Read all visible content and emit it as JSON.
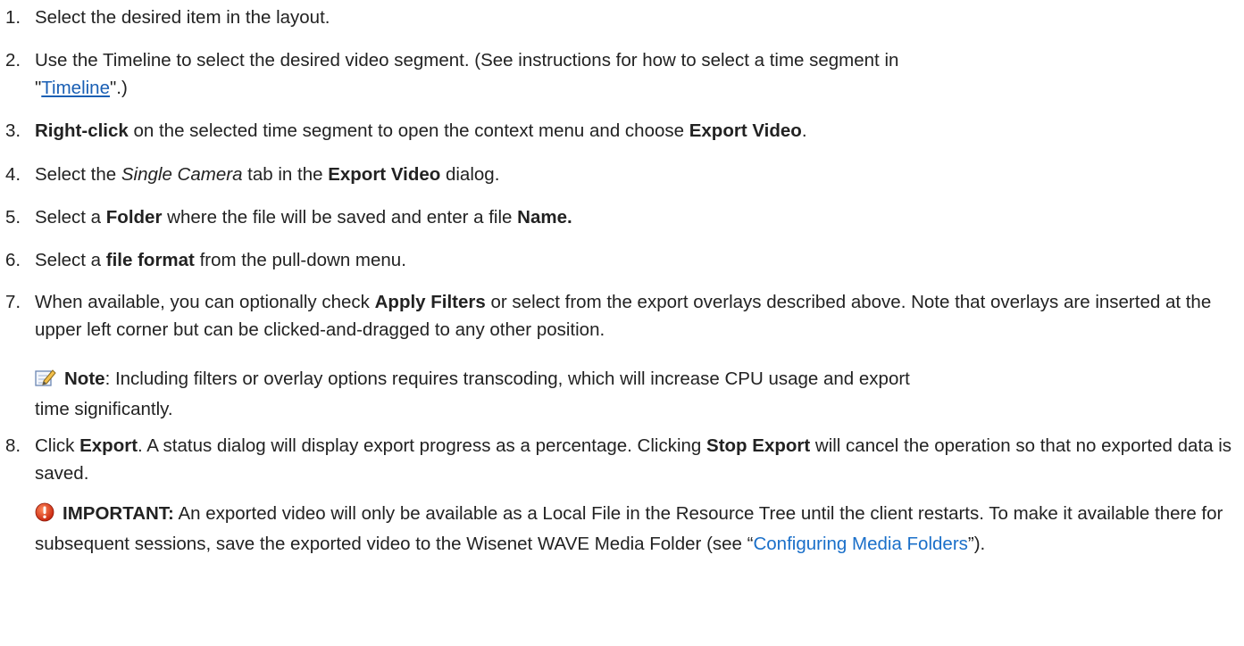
{
  "steps": [
    {
      "num": "1.",
      "text": "Select the desired item in the layout."
    },
    {
      "num": "2.",
      "part1": "Use the Timeline to select the desired video segment. (See instructions for how to select a time segment in",
      "quote_open": "\"",
      "link": "Timeline",
      "quote_close": "\".)"
    },
    {
      "num": "3.",
      "bold1": "Right-click",
      "mid": " on the selected time segment to open the context menu and choose ",
      "bold2": "Export Video",
      "end": "."
    },
    {
      "num": "4.",
      "pre": "Select the ",
      "italic": "Single Camera",
      "mid": " tab in the ",
      "bold": "Export Video",
      "end": " dialog."
    },
    {
      "num": "5.",
      "pre": "Select a ",
      "bold1": "Folder",
      "mid": " where the file will be saved and enter a file ",
      "bold2": "Name."
    },
    {
      "num": "6.",
      "pre": "Select a ",
      "bold": "file format",
      "end": " from the pull-down menu."
    },
    {
      "num": "7.",
      "pre": "When available, you can optionally check ",
      "bold": "Apply Filters",
      "end": " or select from the export overlays described above. Note that overlays are inserted at the upper left corner but can be clicked-and-dragged to any other position."
    },
    {
      "num": "8.",
      "pre": "Click ",
      "bold1": "Export",
      "mid": ". A status dialog will display export progress as a percentage. Clicking ",
      "bold2": "Stop Export",
      "end": " will cancel the operation so that no exported data is saved."
    }
  ],
  "note": {
    "icon": "note-pencil-icon",
    "label": "Note",
    "text": ": Including filters or overlay options requires transcoding, which will increase CPU usage and export",
    "text2": "time significantly."
  },
  "important": {
    "icon": "warning-exclamation-icon",
    "label": "IMPORTANT:",
    "text": " An exported video will only be available as a Local File in the Resource Tree until the client restarts. To make it available there for subsequent sessions, save the exported video to the Wisenet WAVE Media Folder (see “",
    "link": "Configuring Media Folders",
    "end": "”)."
  },
  "colors": {
    "link": "#1a5fb4",
    "text": "#222222",
    "warning": "#d93a1e"
  }
}
